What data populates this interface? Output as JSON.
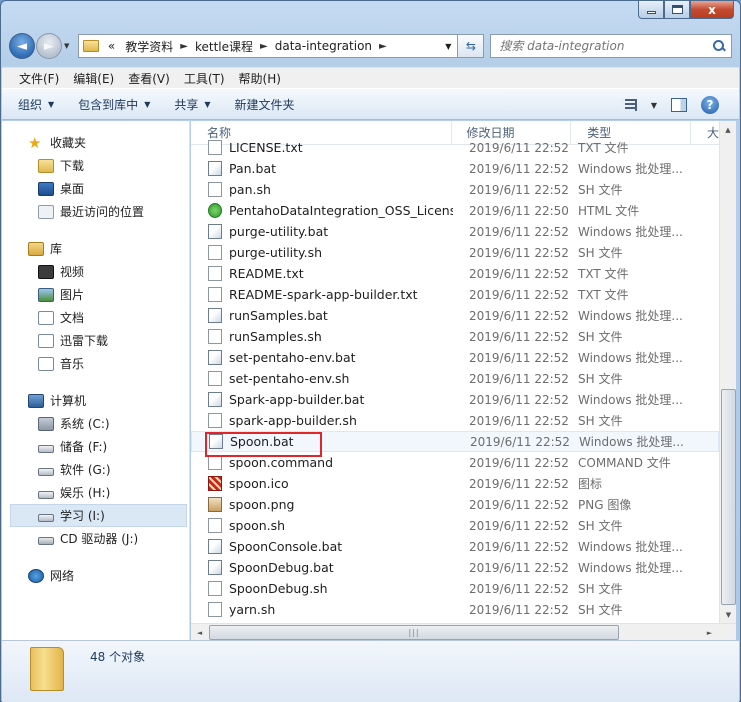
{
  "window": {
    "close_glyph": "x"
  },
  "address": {
    "overflow": "«",
    "crumbs": [
      "教学资料",
      "kettle课程",
      "data-integration"
    ]
  },
  "search": {
    "placeholder": "搜索 data-integration"
  },
  "menu": [
    "文件(F)",
    "编辑(E)",
    "查看(V)",
    "工具(T)",
    "帮助(H)"
  ],
  "commands": [
    {
      "label": "组织",
      "dropdown": true
    },
    {
      "label": "包含到库中",
      "dropdown": true
    },
    {
      "label": "共享",
      "dropdown": true
    },
    {
      "label": "新建文件夹",
      "dropdown": false
    }
  ],
  "nav": {
    "favorites": {
      "label": "收藏夹",
      "items": [
        "下载",
        "桌面",
        "最近访问的位置"
      ]
    },
    "libraries": {
      "label": "库",
      "items": [
        "视频",
        "图片",
        "文档",
        "迅雷下载",
        "音乐"
      ]
    },
    "computer": {
      "label": "计算机",
      "items": [
        "系统 (C:)",
        "储备 (F:)",
        "软件 (G:)",
        "娱乐 (H:)",
        "学习 (I:)",
        "CD 驱动器 (J:)"
      ],
      "selected": "学习 (I:)"
    },
    "network": {
      "label": "网络"
    }
  },
  "columns": {
    "name": "名称",
    "date": "修改日期",
    "type": "类型",
    "more": "大"
  },
  "files": [
    {
      "name": "LICENSE.txt",
      "date": "2019/6/11 22:52",
      "type": "TXT 文件",
      "icon": "text"
    },
    {
      "name": "Pan.bat",
      "date": "2019/6/11 22:52",
      "type": "Windows 批处理...",
      "icon": "bat"
    },
    {
      "name": "pan.sh",
      "date": "2019/6/11 22:52",
      "type": "SH 文件",
      "icon": "text"
    },
    {
      "name": "PentahoDataIntegration_OSS_License...",
      "date": "2019/6/11 22:50",
      "type": "HTML 文件",
      "icon": "html"
    },
    {
      "name": "purge-utility.bat",
      "date": "2019/6/11 22:52",
      "type": "Windows 批处理...",
      "icon": "bat"
    },
    {
      "name": "purge-utility.sh",
      "date": "2019/6/11 22:52",
      "type": "SH 文件",
      "icon": "text"
    },
    {
      "name": "README.txt",
      "date": "2019/6/11 22:52",
      "type": "TXT 文件",
      "icon": "text"
    },
    {
      "name": "README-spark-app-builder.txt",
      "date": "2019/6/11 22:52",
      "type": "TXT 文件",
      "icon": "text"
    },
    {
      "name": "runSamples.bat",
      "date": "2019/6/11 22:52",
      "type": "Windows 批处理...",
      "icon": "bat"
    },
    {
      "name": "runSamples.sh",
      "date": "2019/6/11 22:52",
      "type": "SH 文件",
      "icon": "text"
    },
    {
      "name": "set-pentaho-env.bat",
      "date": "2019/6/11 22:52",
      "type": "Windows 批处理...",
      "icon": "bat"
    },
    {
      "name": "set-pentaho-env.sh",
      "date": "2019/6/11 22:52",
      "type": "SH 文件",
      "icon": "text"
    },
    {
      "name": "Spark-app-builder.bat",
      "date": "2019/6/11 22:52",
      "type": "Windows 批处理...",
      "icon": "bat"
    },
    {
      "name": "spark-app-builder.sh",
      "date": "2019/6/11 22:52",
      "type": "SH 文件",
      "icon": "text"
    },
    {
      "name": "Spoon.bat",
      "date": "2019/6/11 22:52",
      "type": "Windows 批处理...",
      "icon": "bat",
      "highlighted": true
    },
    {
      "name": "spoon.command",
      "date": "2019/6/11 22:52",
      "type": "COMMAND 文件",
      "icon": "text"
    },
    {
      "name": "spoon.ico",
      "date": "2019/6/11 22:52",
      "type": "图标",
      "icon": "ico"
    },
    {
      "name": "spoon.png",
      "date": "2019/6/11 22:52",
      "type": "PNG 图像",
      "icon": "png"
    },
    {
      "name": "spoon.sh",
      "date": "2019/6/11 22:52",
      "type": "SH 文件",
      "icon": "text"
    },
    {
      "name": "SpoonConsole.bat",
      "date": "2019/6/11 22:52",
      "type": "Windows 批处理...",
      "icon": "bat"
    },
    {
      "name": "SpoonDebug.bat",
      "date": "2019/6/11 22:52",
      "type": "Windows 批处理...",
      "icon": "bat"
    },
    {
      "name": "SpoonDebug.sh",
      "date": "2019/6/11 22:52",
      "type": "SH 文件",
      "icon": "text"
    },
    {
      "name": "yarn.sh",
      "date": "2019/6/11 22:52",
      "type": "SH 文件",
      "icon": "text"
    }
  ],
  "status": {
    "count": "48 个对象"
  },
  "colors": {
    "highlight_border": "#e0262a",
    "accent": "#1e395b"
  }
}
